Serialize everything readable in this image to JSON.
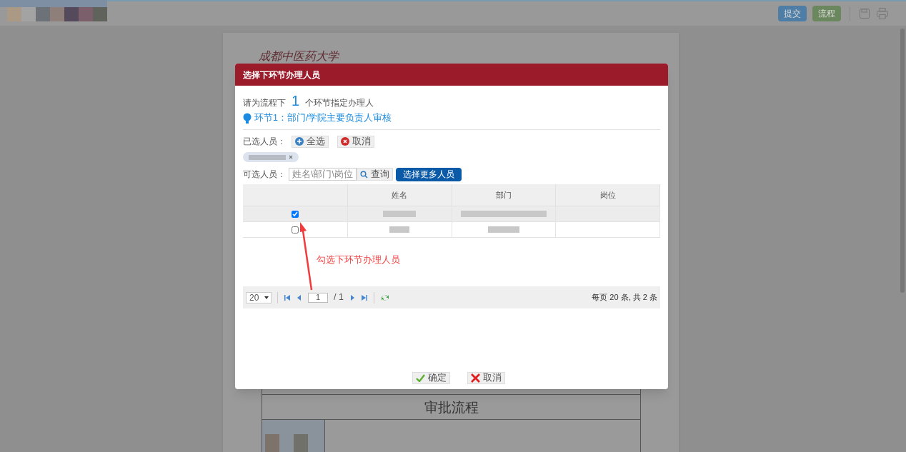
{
  "toolbar": {
    "buttons": [
      {
        "label": "提交",
        "kind": "primary"
      },
      {
        "label": "流程",
        "kind": "success"
      }
    ]
  },
  "document": {
    "logo_text": "成都中医药大学",
    "section_title": "审批流程"
  },
  "dialog": {
    "title": "选择下环节办理人员",
    "prompt": {
      "before": "请为流程下",
      "count": "1",
      "after": "个环节指定办理人"
    },
    "step": "环节1：部门/学院主要负责人审核",
    "selected": {
      "label": "已选人员：",
      "select_all": "全选",
      "clear": "取消",
      "chips": [
        {
          "kind": "redacted"
        }
      ]
    },
    "search": {
      "label": "可选人员：",
      "placeholder": "姓名\\部门\\岗位",
      "button": "查询",
      "more": "选择更多人员"
    },
    "table": {
      "columns": [
        "姓名",
        "部门",
        "岗位"
      ],
      "rows": [
        {
          "checked": true,
          "selected": true
        },
        {
          "checked": false,
          "selected": false
        }
      ]
    },
    "pager": {
      "page_size": "20",
      "page": "1",
      "total": "/ 1",
      "summary": "每页 20 条, 共 2 条"
    },
    "annotation": "勾选下环节办理人员",
    "footer": [
      {
        "label": "确定",
        "kind": "ok"
      },
      {
        "label": "取消",
        "kind": "cancel"
      }
    ]
  }
}
